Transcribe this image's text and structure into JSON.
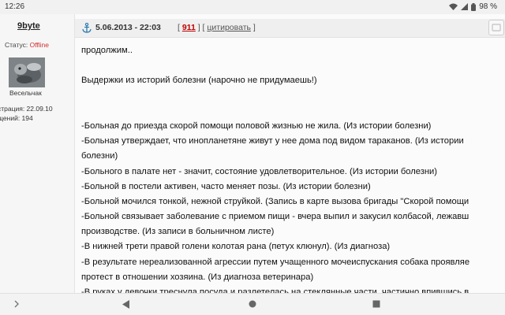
{
  "status_bar": {
    "time": "12:26",
    "battery": "98 %"
  },
  "user": {
    "name": "9byte",
    "status_label": "Статус: ",
    "status_value": "Offline",
    "rank": "Весельчак",
    "registered": "страция: 22.09.10",
    "messages": "щений: 194"
  },
  "post": {
    "date": "5.06.2013 - 22:03",
    "number": "911",
    "quote": "цитировать",
    "lines": [
      "продолжим..",
      "",
      "Выдержки из историй болезни (нарочно не придумаешь!)",
      "",
      "",
      "-Больная до приезда скорой помощи половой жизнью не жила. (Из истории болезни)",
      "-Больная утверждает, что инопланетяне живут у нее дома под видом тараканов. (Из истории",
      "болезни)",
      "-Больного в палате нет - значит, состояние удовлетворительное. (Из истории болезни)",
      "-Больной в постели активен, часто меняет позы. (Из истории болезни)",
      "-Больной мочился тонкой, нежной струйкой. (Запись в карте вызова бригады \"Скорой помощи",
      "-Больной связывает заболевание с приемом пищи - вчера выпил и закусил колбасой, лежавш",
      "производстве. (Из записи в больничном листе)",
      "-В нижней трети правой голени колотая рана (петух клюнул). (Из диагноза)",
      "-В результате нереализованной агрессии путем учащенного мочеиспускания собака проявляе",
      "протест в отношении хозяина. (Из диагноза ветеринара)",
      "-В руках у девочки треснула посуда и разлетелась на стеклянные части, частично впившись в"
    ]
  }
}
